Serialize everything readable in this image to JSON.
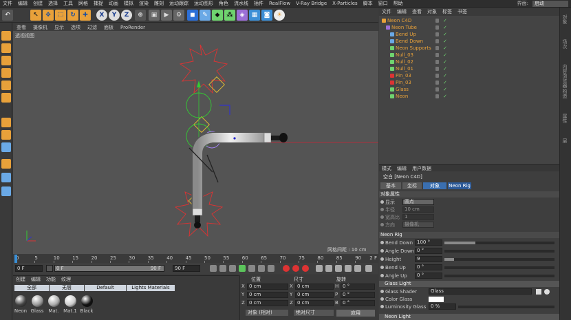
{
  "menubar": {
    "items": [
      "文件",
      "编辑",
      "创建",
      "选择",
      "工具",
      "网格",
      "捕捉",
      "动画",
      "模拟",
      "渲染",
      "雕刻",
      "运动跟踪",
      "运动图形",
      "角色",
      "流水线",
      "插件",
      "RealFlow",
      "V-Ray Bridge",
      "X-Particles",
      "脚本",
      "窗口",
      "帮助"
    ],
    "layout_label": "界面:",
    "layout_value": "启动"
  },
  "toolbar": {
    "icons": [
      "undo-icon",
      "select-icon",
      "move-icon",
      "scale-icon",
      "rotate-icon",
      "axis-x-icon",
      "axis-y-icon",
      "axis-z-icon",
      "coordinate-icon",
      "render-region-icon",
      "render-icon",
      "render-settings-icon",
      "cube-icon",
      "spline-pen-icon",
      "subdivision-icon",
      "array-icon",
      "deformer-icon",
      "floor-icon",
      "camera-icon",
      "light-icon"
    ],
    "axis_x": "X",
    "axis_y": "Y",
    "axis_z": "Z"
  },
  "viewport": {
    "menu": [
      "查看",
      "摄像机",
      "显示",
      "选项",
      "过滤",
      "面板",
      "ProRender"
    ],
    "label": "透视视图",
    "grid_spacing": "网格间距 : 10 cm"
  },
  "timeline": {
    "ticks": [
      "0",
      "5",
      "10",
      "15",
      "20",
      "25",
      "30",
      "35",
      "40",
      "45",
      "50",
      "55",
      "60",
      "65",
      "70",
      "75",
      "80",
      "85",
      "90"
    ],
    "frame_end_label": "2 F"
  },
  "playbar": {
    "current_frame": "0 F",
    "start_frame": "0 F",
    "end_frame_a": "90 F",
    "end_frame_b": "90 F"
  },
  "materials": {
    "menu": [
      "创建",
      "编辑",
      "功能",
      "纹理"
    ],
    "tabs": [
      "全部",
      "无层",
      "Default",
      "Lights Materials"
    ],
    "items": [
      {
        "name": "Neon",
        "color": "#444"
      },
      {
        "name": "Glass",
        "color": "#999"
      },
      {
        "name": "Mat.",
        "color": "#aaa"
      },
      {
        "name": "Mat.1",
        "color": "#ccc"
      },
      {
        "name": "Black",
        "color": "#111"
      }
    ]
  },
  "coordinates": {
    "headers": {
      "position": "位置",
      "size": "尺寸",
      "rotation": "旋转"
    },
    "rows": [
      {
        "axis": "X",
        "pos": "0 cm",
        "size": "0 cm",
        "rot_label": "H",
        "rot": "0 °"
      },
      {
        "axis": "Y",
        "pos": "0 cm",
        "size": "0 cm",
        "rot_label": "P",
        "rot": "0 °"
      },
      {
        "axis": "Z",
        "pos": "0 cm",
        "size": "0 cm",
        "rot_label": "B",
        "rot": "0 °"
      }
    ],
    "mode_select": "对象 (相对)",
    "size_select": "绝对尺寸",
    "apply": "应用"
  },
  "objects": {
    "menu": [
      "文件",
      "编辑",
      "查看",
      "对象",
      "标签",
      "书签"
    ],
    "items": [
      {
        "name": "Neon C4D",
        "level": 0,
        "color": "#e8a13a"
      },
      {
        "name": "Neon Tube",
        "level": 1,
        "color": "#e8a13a"
      },
      {
        "name": "Bend Up",
        "level": 2,
        "color": "#e8a13a"
      },
      {
        "name": "Bend Down",
        "level": 2,
        "color": "#e8a13a"
      },
      {
        "name": "Neon Supports",
        "level": 2,
        "color": "#e8a13a"
      },
      {
        "name": "Null_03",
        "level": 2,
        "color": "#e8a13a"
      },
      {
        "name": "Null_02",
        "level": 2,
        "color": "#e8a13a"
      },
      {
        "name": "Null_01",
        "level": 2,
        "color": "#e8a13a"
      },
      {
        "name": "Pin_03",
        "level": 2,
        "color": "#e8a13a"
      },
      {
        "name": "Pin_03",
        "level": 2,
        "color": "#e8a13a"
      },
      {
        "name": "Glass",
        "level": 2,
        "color": "#e8a13a"
      },
      {
        "name": "Neon",
        "level": 2,
        "color": "#e8a13a"
      }
    ]
  },
  "attributes": {
    "menu": [
      "模式",
      "编辑",
      "用户数据"
    ],
    "title": "空白 [Neon C4D]",
    "tabs": [
      "基本",
      "坐标",
      "对象",
      "Neon Rig"
    ],
    "object_section": "对象属性",
    "display_label": "显示",
    "display_value": "圆点",
    "radius_label": "半径",
    "radius_value": "10 cm",
    "aspect_label": "宽高比",
    "aspect_value": "1",
    "orientation_label": "方向",
    "orientation_value": "摄像机",
    "rig_section": "Neon Rig",
    "params": [
      {
        "label": "Bend Down",
        "value": "100 °",
        "fill": 0.28
      },
      {
        "label": "Angle Down",
        "value": "0 °",
        "fill": 0
      },
      {
        "label": "Height",
        "value": "9",
        "fill": 0.09
      },
      {
        "label": "Bend Up",
        "value": "0 °",
        "fill": 0
      },
      {
        "label": "Angle Up",
        "value": "0 °",
        "fill": 0
      }
    ],
    "glass_section": "Glass Light",
    "glass_shader_label": "Glass Shader",
    "glass_shader_value": "Glass",
    "color_glass_label": "Color Glass",
    "luminosity_label": "Luminosity Glass",
    "luminosity_value": "0 %",
    "neon_light_section": "Neon Light"
  },
  "right_strip": {
    "labels": [
      "对象",
      "场次",
      "内容浏览器",
      "构造",
      "属性",
      "层"
    ]
  }
}
